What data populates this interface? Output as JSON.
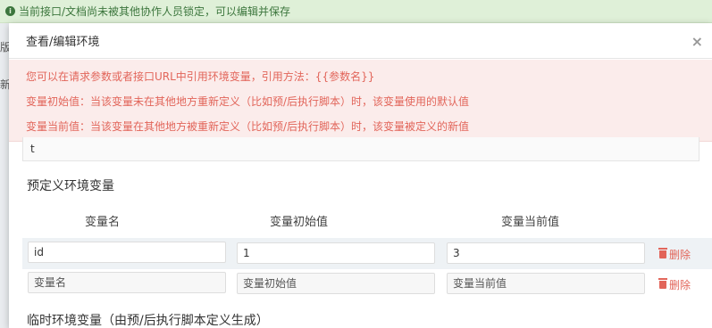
{
  "banner": {
    "text": "当前接口/文档尚未被其他协作人员锁定，可以编辑并保存"
  },
  "background": {
    "frag1": "版",
    "frag2": "新"
  },
  "modal": {
    "title": "查看/编辑环境",
    "close": "×",
    "alert_lines": [
      "您可以在请求参数或者接口URL中引用环境变量，引用方法：{{参数名}}",
      "变量初始值：当该变量未在其他地方重新定义（比如预/后执行脚本）时，该变量使用的默认值",
      "变量当前值：当该变量在其他地方被重新定义（比如预/后执行脚本）时，该变量被定义的新值"
    ],
    "partial_field_value": "t",
    "predefined_title": "预定义环境变量",
    "columns": [
      "变量名",
      "变量初始值",
      "变量当前值"
    ],
    "rows": [
      {
        "name": "id",
        "initial": "1",
        "current": "3",
        "delete_label": "删除"
      }
    ],
    "new_row": {
      "name_placeholder": "变量名",
      "initial_placeholder": "变量初始值",
      "current_placeholder": "变量当前值",
      "delete_label": "删除"
    },
    "temp_title": "临时环境变量（由预/后执行脚本定义生成）"
  }
}
